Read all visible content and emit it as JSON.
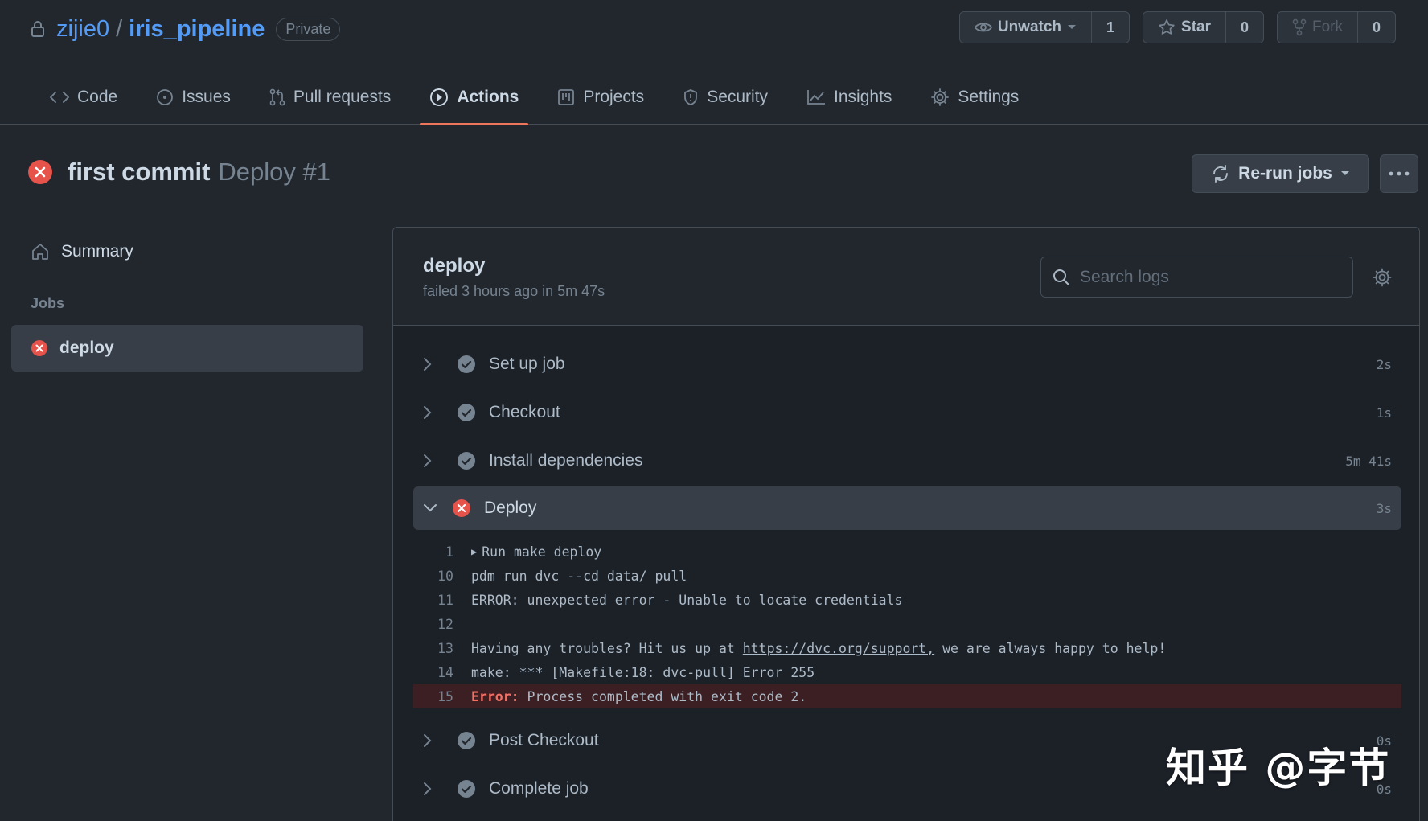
{
  "repo": {
    "owner": "zijie0",
    "separator": "/",
    "name": "iris_pipeline",
    "visibility": "Private"
  },
  "header_buttons": {
    "watch_label": "Unwatch",
    "watch_count": "1",
    "star_label": "Star",
    "star_count": "0",
    "fork_label": "Fork",
    "fork_count": "0"
  },
  "nav": {
    "code": "Code",
    "issues": "Issues",
    "pulls": "Pull requests",
    "actions": "Actions",
    "projects": "Projects",
    "security": "Security",
    "insights": "Insights",
    "settings": "Settings"
  },
  "run": {
    "title": "first commit",
    "subtitle": "Deploy #1",
    "rerun_label": "Re-run jobs"
  },
  "sidebar": {
    "summary": "Summary",
    "jobs_label": "Jobs",
    "job": "deploy"
  },
  "job": {
    "name": "deploy",
    "meta": "failed 3 hours ago in 5m 47s",
    "search_placeholder": "Search logs"
  },
  "steps": [
    {
      "name": "Set up job",
      "time": "2s",
      "status": "success"
    },
    {
      "name": "Checkout",
      "time": "1s",
      "status": "success"
    },
    {
      "name": "Install dependencies",
      "time": "5m 41s",
      "status": "success"
    },
    {
      "name": "Deploy",
      "time": "3s",
      "status": "failure"
    },
    {
      "name": "Post Checkout",
      "time": "0s",
      "status": "success"
    },
    {
      "name": "Complete job",
      "time": "0s",
      "status": "success"
    }
  ],
  "log": {
    "l1_num": "1",
    "l1_text": "Run make deploy",
    "l10_num": "10",
    "l10_text": "pdm run dvc --cd data/ pull",
    "l11_num": "11",
    "l11_text": "ERROR: unexpected error - Unable to locate credentials",
    "l12_num": "12",
    "l12_text": "",
    "l13_num": "13",
    "l13_pre": "Having any troubles? Hit us up at ",
    "l13_link": "https://dvc.org/support,",
    "l13_post": " we are always happy to help!",
    "l14_num": "14",
    "l14_text": "make: *** [Makefile:18: dvc-pull] Error 255",
    "l15_num": "15",
    "l15_kw": "Error:",
    "l15_text": " Process completed with exit code 2."
  },
  "watermark": "知乎 @字节",
  "colors": {
    "bg": "#22272e",
    "accent_tab": "#ec775c",
    "link": "#539bf5",
    "error": "#e5534b",
    "success": "#768390"
  }
}
